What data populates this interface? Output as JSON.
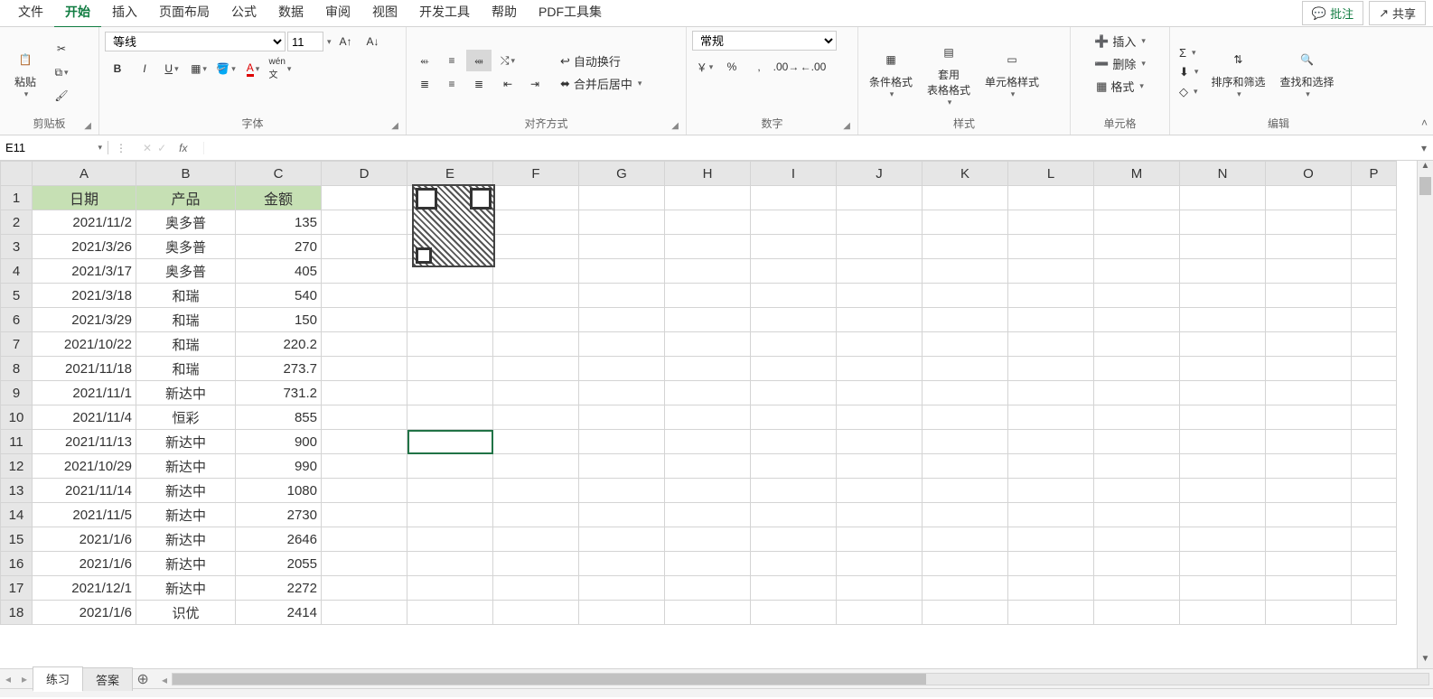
{
  "menu": {
    "items": [
      "文件",
      "开始",
      "插入",
      "页面布局",
      "公式",
      "数据",
      "审阅",
      "视图",
      "开发工具",
      "帮助",
      "PDF工具集"
    ],
    "active_index": 1,
    "comment_btn": "批注",
    "share_btn": "共享"
  },
  "ribbon": {
    "clipboard": {
      "paste": "粘贴",
      "label": "剪贴板"
    },
    "font": {
      "name": "等线",
      "size": "11",
      "label": "字体"
    },
    "alignment": {
      "wrap": "自动换行",
      "merge": "合并后居中",
      "label": "对齐方式"
    },
    "number": {
      "format": "常规",
      "label": "数字"
    },
    "styles": {
      "cond_fmt": "条件格式",
      "table_fmt": "套用",
      "table_fmt2": "表格格式",
      "cell_style": "单元格样式",
      "label": "样式"
    },
    "cells": {
      "insert": "插入",
      "delete": "删除",
      "format": "格式",
      "label": "单元格"
    },
    "editing": {
      "sort_filter": "排序和筛选",
      "find_select": "查找和选择",
      "label": "编辑"
    }
  },
  "formula_bar": {
    "cell_ref": "E11",
    "fx": "fx",
    "value": ""
  },
  "columns": [
    "A",
    "B",
    "C",
    "D",
    "E",
    "F",
    "G",
    "H",
    "I",
    "J",
    "K",
    "L",
    "M",
    "N",
    "O",
    "P"
  ],
  "rows": [
    1,
    2,
    3,
    4,
    5,
    6,
    7,
    8,
    9,
    10,
    11,
    12,
    13,
    14,
    15,
    16,
    17,
    18
  ],
  "headers": {
    "A": "日期",
    "B": "产品",
    "C": "金额"
  },
  "data": [
    {
      "A": "2021/11/2",
      "B": "奥多普",
      "C": "135"
    },
    {
      "A": "2021/3/26",
      "B": "奥多普",
      "C": "270"
    },
    {
      "A": "2021/3/17",
      "B": "奥多普",
      "C": "405"
    },
    {
      "A": "2021/3/18",
      "B": "和瑞",
      "C": "540"
    },
    {
      "A": "2021/3/29",
      "B": "和瑞",
      "C": "150"
    },
    {
      "A": "2021/10/22",
      "B": "和瑞",
      "C": "220.2"
    },
    {
      "A": "2021/11/18",
      "B": "和瑞",
      "C": "273.7"
    },
    {
      "A": "2021/11/1",
      "B": "新达中",
      "C": "731.2"
    },
    {
      "A": "2021/11/4",
      "B": "恒彩",
      "C": "855"
    },
    {
      "A": "2021/11/13",
      "B": "新达中",
      "C": "900"
    },
    {
      "A": "2021/10/29",
      "B": "新达中",
      "C": "990"
    },
    {
      "A": "2021/11/14",
      "B": "新达中",
      "C": "1080"
    },
    {
      "A": "2021/11/5",
      "B": "新达中",
      "C": "2730"
    },
    {
      "A": "2021/1/6",
      "B": "新达中",
      "C": "2646"
    },
    {
      "A": "2021/1/6",
      "B": "新达中",
      "C": "2055"
    },
    {
      "A": "2021/12/1",
      "B": "新达中",
      "C": "2272"
    },
    {
      "A": "2021/1/6",
      "B": "识优",
      "C": "2414"
    }
  ],
  "selected_cell": "E11",
  "sheets": {
    "tabs": [
      "练习",
      "答案"
    ],
    "active_index": 0
  }
}
